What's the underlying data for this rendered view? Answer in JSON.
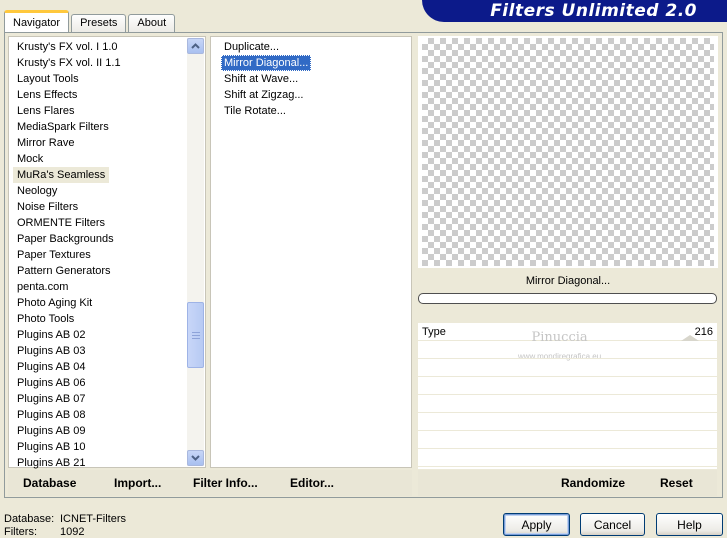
{
  "window": {
    "title": "Filters Unlimited 2.0"
  },
  "tabs": [
    {
      "label": "Navigator",
      "active": true
    },
    {
      "label": "Presets",
      "active": false
    },
    {
      "label": "About",
      "active": false
    }
  ],
  "categories": {
    "items": [
      "Krusty's FX vol. I 1.0",
      "Krusty's FX vol. II 1.1",
      "Layout Tools",
      "Lens Effects",
      "Lens Flares",
      "MediaSpark Filters",
      "Mirror Rave",
      "Mock",
      "MuRa's Seamless",
      "Neology",
      "Noise Filters",
      "ORMENTE Filters",
      "Paper Backgrounds",
      "Paper Textures",
      "Pattern Generators",
      "penta.com",
      "Photo Aging Kit",
      "Photo Tools",
      "Plugins AB 02",
      "Plugins AB 03",
      "Plugins AB 04",
      "Plugins AB 06",
      "Plugins AB 07",
      "Plugins AB 08",
      "Plugins AB 09",
      "Plugins AB 10",
      "Plugins AB 21"
    ],
    "selected": "MuRa's Seamless"
  },
  "filters": {
    "items": [
      "Duplicate...",
      "Mirror Diagonal...",
      "Shift at Wave...",
      "Shift at Zigzag...",
      "Tile Rotate..."
    ],
    "selected": "Mirror Diagonal..."
  },
  "preview": {
    "filter_name": "Mirror Diagonal...",
    "progress": 0
  },
  "params": [
    {
      "label": "Type",
      "value": "216"
    }
  ],
  "watermark": {
    "title": "Pinuccia",
    "subtitle": "www.mondiregrafica.eu"
  },
  "buttons_left": {
    "database": "Database",
    "import": "Import...",
    "filter_info": "Filter Info...",
    "editor": "Editor..."
  },
  "buttons_right": {
    "randomize": "Randomize",
    "reset": "Reset"
  },
  "status": {
    "database_label": "Database:",
    "database_value": "ICNET-Filters",
    "filters_label": "Filters:",
    "filters_value": "1092"
  },
  "dialog": {
    "apply": "Apply",
    "cancel": "Cancel",
    "help": "Help"
  }
}
